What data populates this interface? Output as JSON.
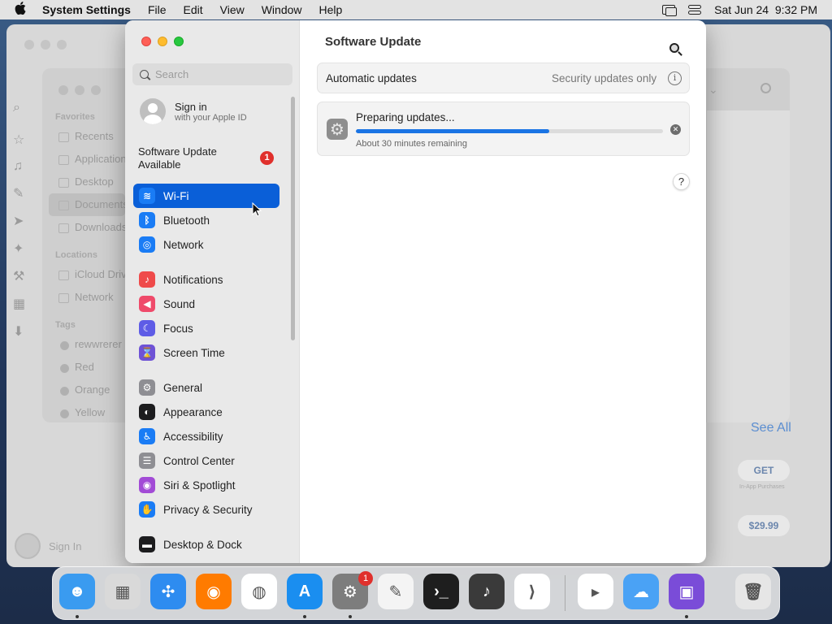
{
  "menubar": {
    "app_name": "System Settings",
    "menus": [
      "File",
      "Edit",
      "View",
      "Window",
      "Help"
    ],
    "clock": "Sat Jun 24  9:32 PM"
  },
  "bg_finder": {
    "sections": {
      "favorites": "Favorites",
      "locations": "Locations",
      "tags": "Tags"
    },
    "favorites": [
      "Recents",
      "Applications",
      "Desktop",
      "Documents",
      "Downloads"
    ],
    "locations": [
      "iCloud Drive",
      "Network"
    ],
    "tags": [
      "rewwrerer",
      "Red",
      "Orange",
      "Yellow"
    ]
  },
  "bg_appstore": {
    "see_all": "See All",
    "get": "GET",
    "in_app": "In-App Purchases",
    "price": "$29.99",
    "sign_in": "Sign In"
  },
  "sidebar": {
    "search_placeholder": "Search",
    "account": {
      "title": "Sign in",
      "subtitle": "with your Apple ID"
    },
    "software_update": {
      "label": "Software Update Available",
      "badge": "1"
    },
    "items": [
      {
        "label": "Wi-Fi",
        "icon": "wifi-icon",
        "color": "#1a7cf5"
      },
      {
        "label": "Bluetooth",
        "icon": "bluetooth-icon",
        "color": "#1a7cf5"
      },
      {
        "label": "Network",
        "icon": "globe-icon",
        "color": "#1a7cf5"
      },
      {
        "label": "Notifications",
        "icon": "bell-icon",
        "color": "#ef4a4a"
      },
      {
        "label": "Sound",
        "icon": "speaker-icon",
        "color": "#ef4a6a"
      },
      {
        "label": "Focus",
        "icon": "moon-icon",
        "color": "#5e5ce6"
      },
      {
        "label": "Screen Time",
        "icon": "hourglass-icon",
        "color": "#6e52d6"
      },
      {
        "label": "General",
        "icon": "gear-icon",
        "color": "#8e8e93"
      },
      {
        "label": "Appearance",
        "icon": "appearance-icon",
        "color": "#1c1c1e"
      },
      {
        "label": "Accessibility",
        "icon": "accessibility-icon",
        "color": "#1a7cf5"
      },
      {
        "label": "Control Center",
        "icon": "control-center-icon",
        "color": "#8e8e93"
      },
      {
        "label": "Siri & Spotlight",
        "icon": "siri-icon",
        "color": "#a24bd6"
      },
      {
        "label": "Privacy & Security",
        "icon": "hand-icon",
        "color": "#1a7cf5"
      },
      {
        "label": "Desktop & Dock",
        "icon": "dock-icon",
        "color": "#1c1c1e"
      }
    ]
  },
  "main": {
    "title": "Software Update",
    "auto_updates": {
      "label": "Automatic updates",
      "value": "Security updates only"
    },
    "progress": {
      "title": "Preparing updates...",
      "remaining": "About 30 minutes remaining",
      "fraction": 0.63
    },
    "help": "?"
  },
  "dock": {
    "badge": "1",
    "apps": [
      "Finder",
      "Launchpad",
      "Safari",
      "Firefox",
      "Chrome",
      "App Store",
      "System Settings",
      "TextEdit",
      "Terminal",
      "GarageBand",
      "Visual Studio Code",
      "Visual Studio",
      "Weather",
      "Simulator",
      "Trash"
    ]
  }
}
